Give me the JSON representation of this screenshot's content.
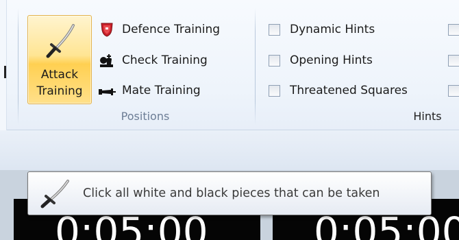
{
  "ribbon": {
    "positions_group": {
      "attack_training_label": "Attack\nTraining",
      "defence_training_label": "Defence Training",
      "check_training_label": "Check Training",
      "mate_training_label": "Mate Training",
      "group_label": "Positions"
    },
    "hints_group": {
      "dynamic_hints_label": "Dynamic Hints",
      "opening_hints_label": "Opening Hints",
      "threatened_squares_label": "Threatened Squares",
      "group_label": "Hints",
      "checked": [
        false,
        false,
        false
      ]
    }
  },
  "tooltip": {
    "text": "Click all white and black pieces that can be taken"
  },
  "clocks": {
    "white_time": "0:05:00",
    "black_time": "0:05:00"
  },
  "colors": {
    "selected_button": "#ffd052",
    "tooltip_border": "#767676",
    "clock_bg": "#050505"
  },
  "icons": {
    "attack": "sword-icon",
    "defence": "shield-icon",
    "check": "king-pieces-icon",
    "mate": "fallen-king-icon"
  }
}
